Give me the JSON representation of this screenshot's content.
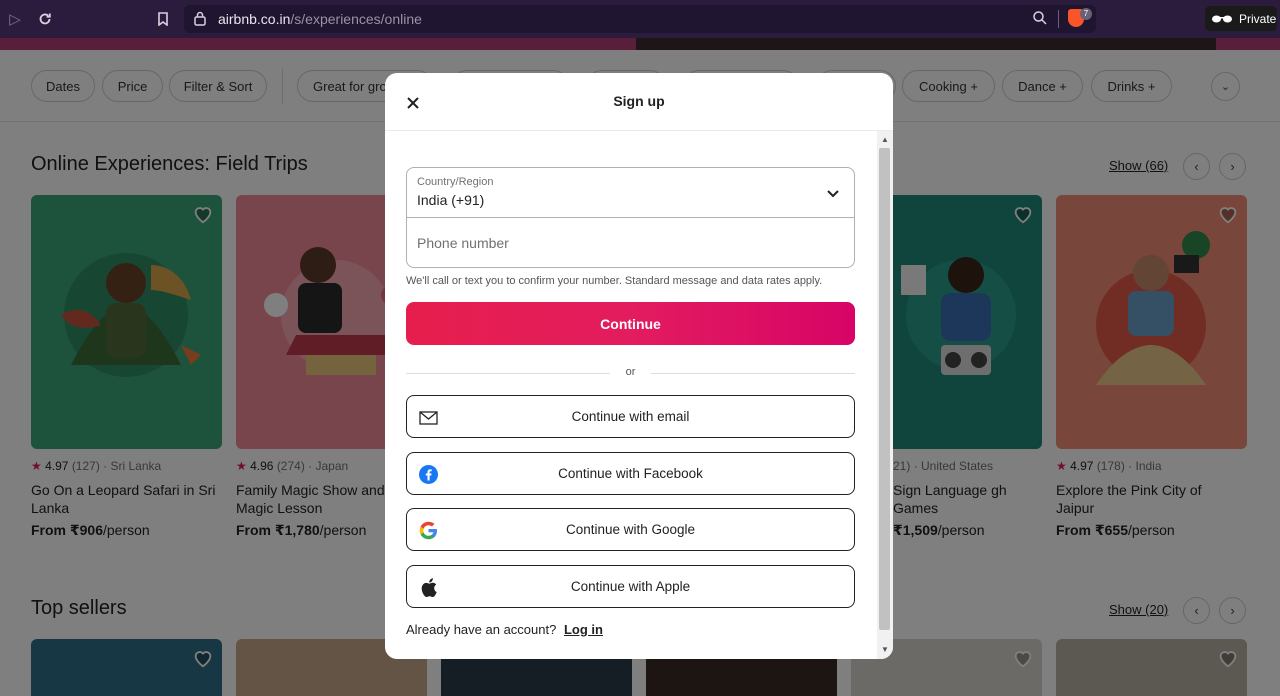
{
  "browser": {
    "url_host": "airbnb.co.in",
    "url_path": "/s/experiences/online",
    "shield_count": "7",
    "private_label": "Private"
  },
  "filters": [
    "Dates",
    "Price",
    "Filter & Sort",
    "Great for gro",
    "Cooking +",
    "Dance +",
    "Drinks +"
  ],
  "sections": {
    "field_trips": {
      "title": "Online Experiences: Field Trips",
      "show_label": "Show (66)",
      "cards": [
        {
          "rating": "4.97",
          "reviews": "(127)",
          "location": "· Sri Lanka",
          "title": "Go On a Leopard Safari in Sri Lanka",
          "price_from": "From ₹906",
          "price_unit": "/person",
          "bg": "#3aa57a"
        },
        {
          "rating": "4.96",
          "reviews": "(274)",
          "location": "· Japan",
          "title": "Family Magic Show and Magic Lesson",
          "price_from": "From ₹1,780",
          "price_unit": "/person",
          "bg": "#f08a9b"
        },
        {
          "rating": "",
          "reviews": "21)",
          "location": "· United States",
          "title": "Sign Language gh Games",
          "price_from": "₹1,509",
          "price_unit": "/person",
          "bg": "#1f8a7a"
        },
        {
          "rating": "4.97",
          "reviews": "(178)",
          "location": "· India",
          "title": "Explore the Pink City of Jaipur",
          "price_from": "From ₹655",
          "price_unit": "/person",
          "bg": "#f08c74"
        }
      ]
    },
    "top_sellers": {
      "title": "Top sellers",
      "show_label": "Show (20)"
    }
  },
  "modal": {
    "title": "Sign up",
    "country_label": "Country/Region",
    "country_value": "India (+91)",
    "phone_placeholder": "Phone number",
    "disclaimer": "We'll call or text you to confirm your number. Standard message and data rates apply.",
    "continue_label": "Continue",
    "or_label": "or",
    "social": [
      {
        "label": "Continue with email",
        "icon": "envelope-icon"
      },
      {
        "label": "Continue with Facebook",
        "icon": "facebook-icon"
      },
      {
        "label": "Continue with Google",
        "icon": "google-icon"
      },
      {
        "label": "Continue with Apple",
        "icon": "apple-icon"
      }
    ],
    "login_prompt": "Already have an account?",
    "login_link": "Log in"
  },
  "colors": {
    "brand": "#e31c5f",
    "chrome_bg": "#2b1c3d",
    "facebook": "#1877f2"
  }
}
